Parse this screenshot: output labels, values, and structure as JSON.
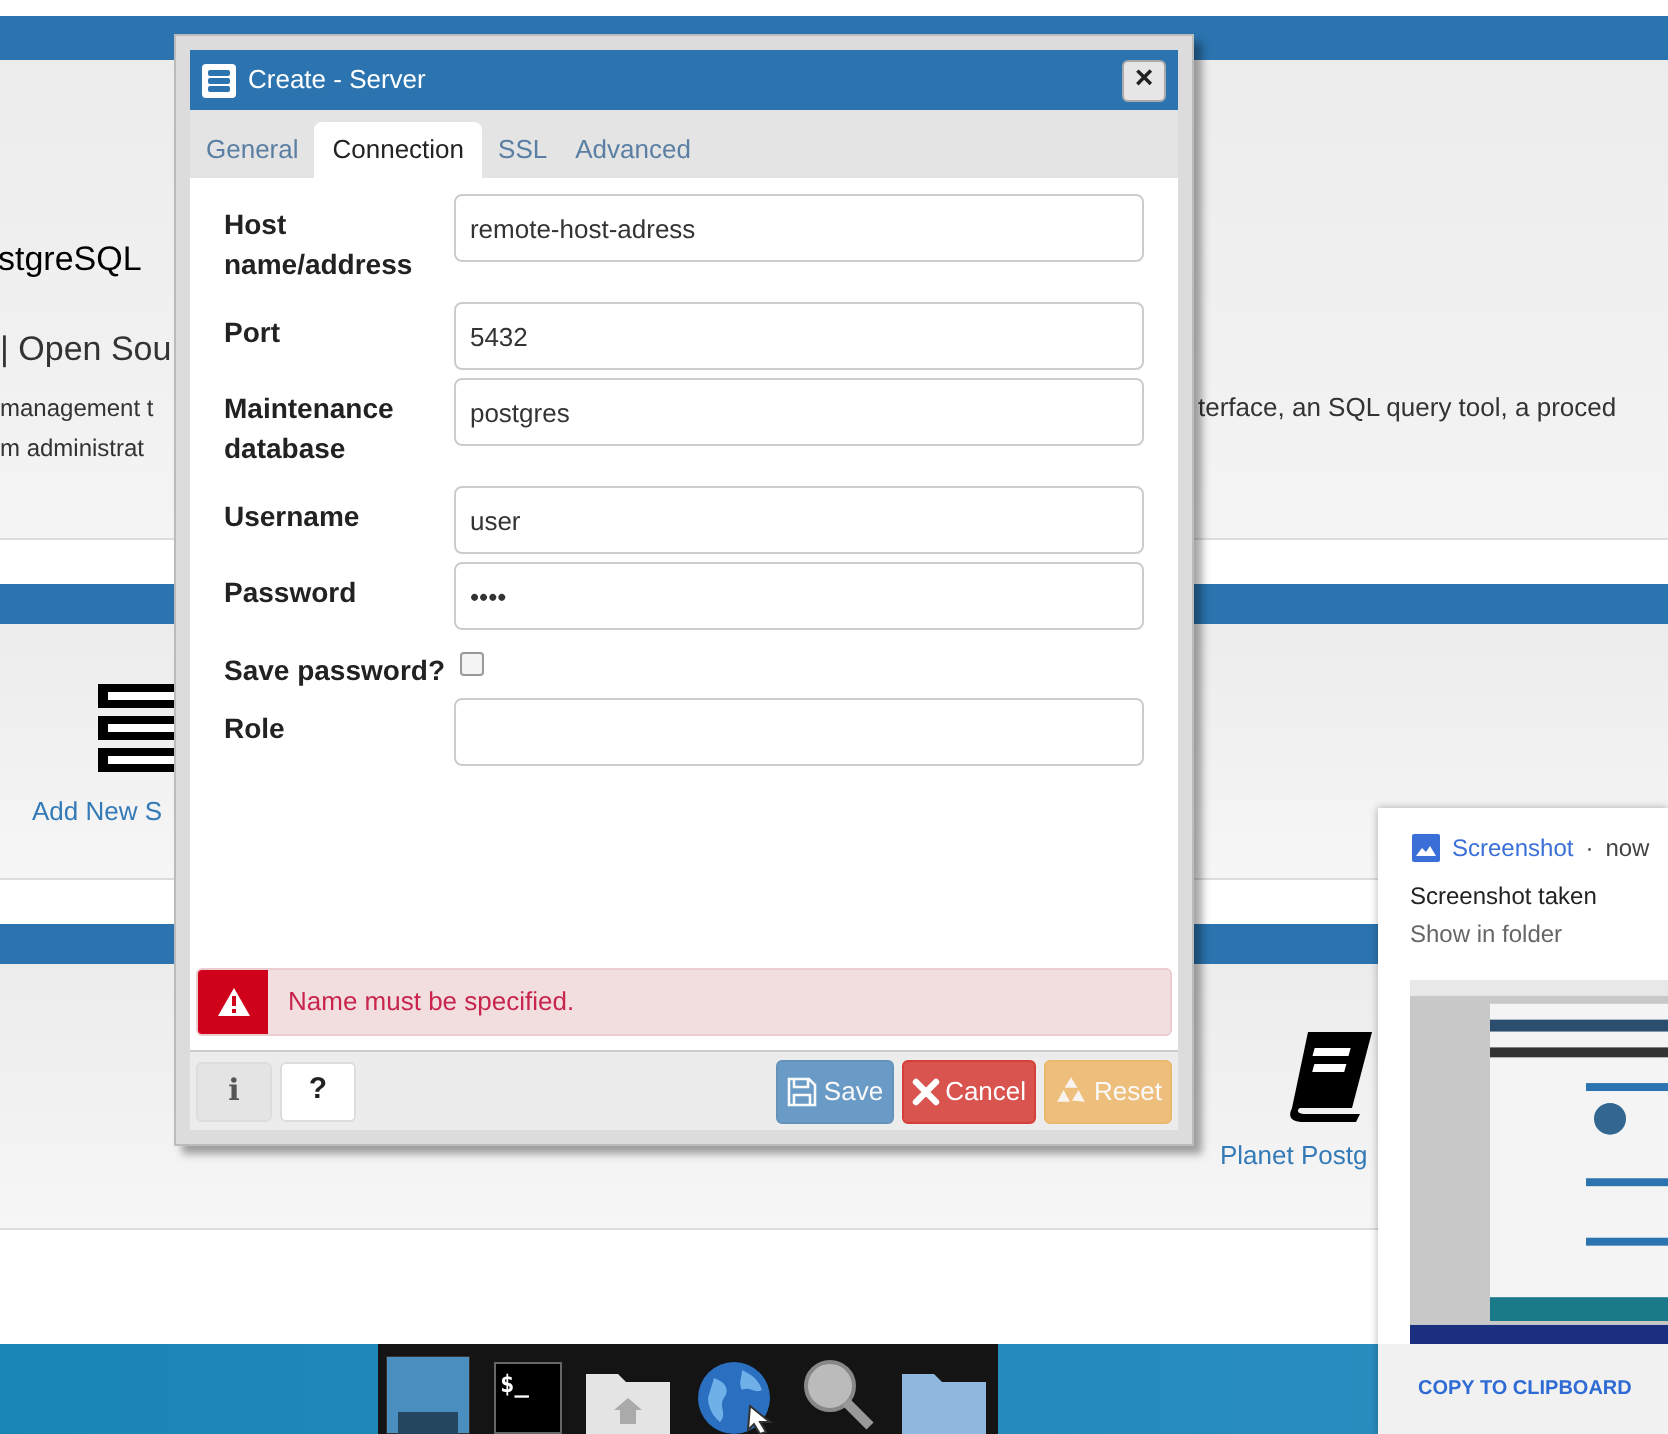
{
  "page": {
    "title_fragment": "stgreSQL",
    "subtitle_fragment": "| Open Sou",
    "desc_left": [
      "management t",
      "m administrat"
    ],
    "desc_right": "terface, an SQL query tool, a proced",
    "add_server_link": "Add New S",
    "planet_link": "Planet Postg"
  },
  "dialog": {
    "title": "Create - Server",
    "close": "×",
    "tabs": [
      {
        "label": "General",
        "selected": false
      },
      {
        "label": "Connection",
        "selected": true
      },
      {
        "label": "SSL",
        "selected": false
      },
      {
        "label": "Advanced",
        "selected": false
      }
    ],
    "fields": [
      {
        "kind": "text",
        "label": "Host name/address",
        "value": "remote-host-adress"
      },
      {
        "kind": "text",
        "label": "Port",
        "value": "5432"
      },
      {
        "kind": "text",
        "label": "Maintenance database",
        "value": "postgres"
      },
      {
        "kind": "text",
        "label": "Username",
        "value": "user"
      },
      {
        "kind": "text",
        "label": "Password",
        "value": "••••"
      },
      {
        "kind": "checkbox",
        "label": "Save password?",
        "checked": false
      },
      {
        "kind": "text",
        "label": "Role"
      }
    ],
    "error": "Name must be specified.",
    "info_button": "i",
    "help_button": "?",
    "buttons": [
      {
        "kind": "save",
        "label": "Save",
        "disabled": true
      },
      {
        "kind": "cancel",
        "label": "Cancel",
        "disabled": false
      },
      {
        "kind": "reset",
        "label": "Reset",
        "disabled": true
      }
    ]
  },
  "dock": {
    "terminal_label": "$_"
  },
  "notification": {
    "app": "Screenshot",
    "separator": "·",
    "time": "now",
    "title": "Screenshot taken",
    "subtitle": "Show in folder",
    "action": "COPY TO CLIPBOARD"
  }
}
